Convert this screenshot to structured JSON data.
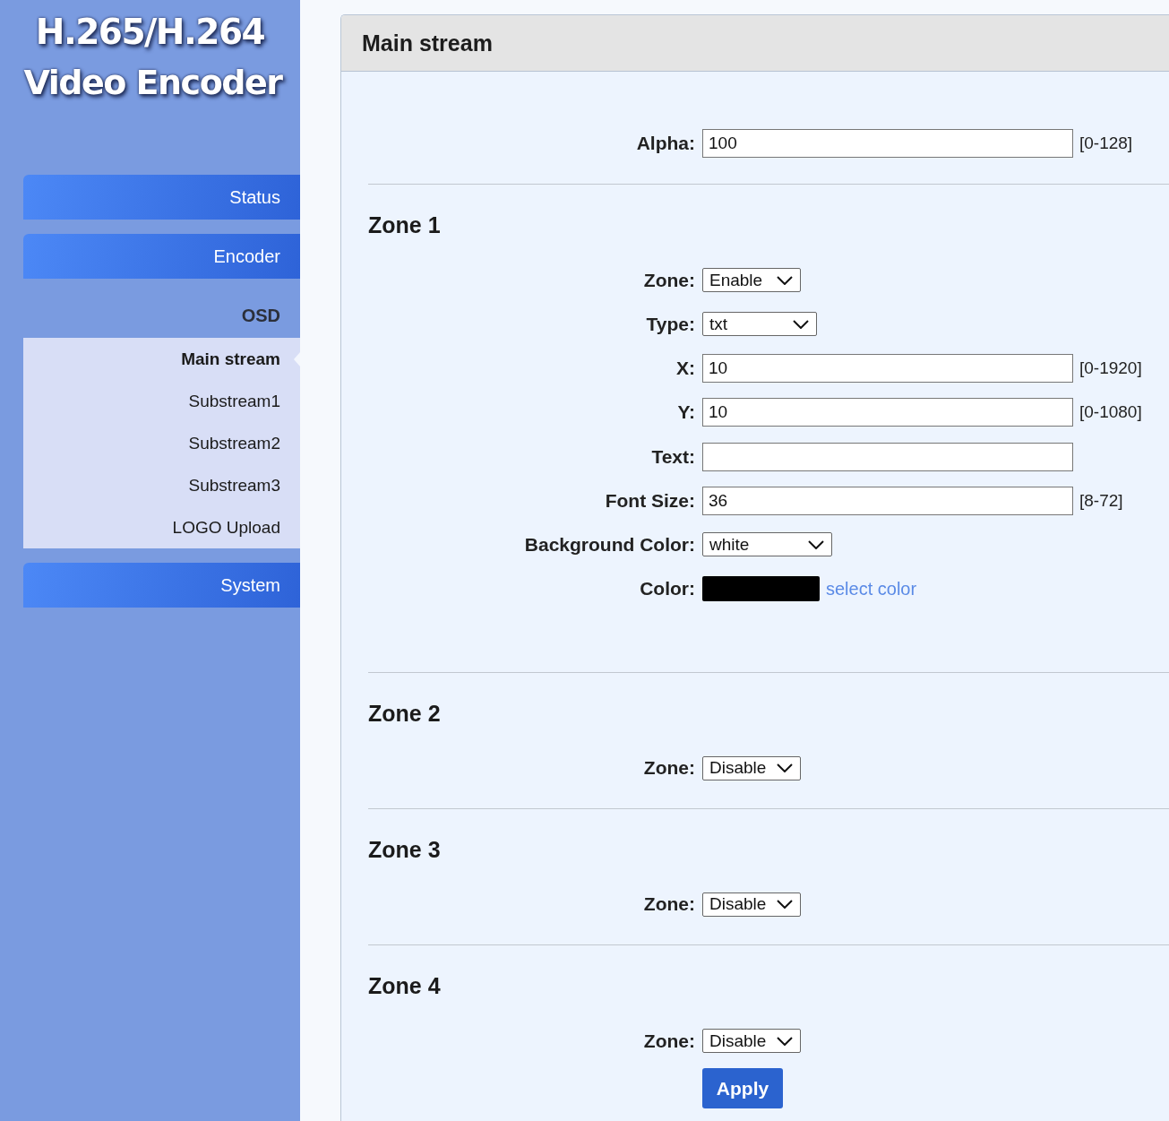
{
  "logo": {
    "lines": [
      "H.265/H.264",
      "Video Encoder"
    ]
  },
  "sidebar": {
    "items": [
      {
        "kind": "button",
        "label": "Status"
      },
      {
        "kind": "button",
        "label": "Encoder"
      },
      {
        "kind": "heading",
        "label": "OSD",
        "children": [
          {
            "label": "Main stream",
            "selected": true
          },
          {
            "label": "Substream1",
            "selected": false
          },
          {
            "label": "Substream2",
            "selected": false
          },
          {
            "label": "Substream3",
            "selected": false
          },
          {
            "label": "LOGO Upload",
            "selected": false
          }
        ]
      },
      {
        "kind": "button",
        "label": "System"
      }
    ]
  },
  "panel": {
    "title": "Main stream",
    "alpha": {
      "label": "Alpha:",
      "value": "100",
      "hint": "[0-128]"
    },
    "zones": [
      {
        "title": "Zone 1",
        "fields": [
          {
            "kind": "select",
            "label": "Zone:",
            "value": "Enable"
          },
          {
            "kind": "select",
            "label": "Type:",
            "value": "txt"
          },
          {
            "kind": "text",
            "label": "X:",
            "value": "10",
            "hint": "[0-1920]"
          },
          {
            "kind": "text",
            "label": "Y:",
            "value": "10",
            "hint": "[0-1080]"
          },
          {
            "kind": "text",
            "label": "Text:"
          },
          {
            "kind": "text",
            "label": "Font Size:",
            "value": "36",
            "hint": "[8-72]"
          },
          {
            "kind": "select",
            "label": "Background Color:",
            "value": "white"
          },
          {
            "kind": "color",
            "label": "Color:",
            "color": "#000000",
            "link": "select color"
          }
        ]
      },
      {
        "title": "Zone 2",
        "fields": [
          {
            "kind": "select",
            "label": "Zone:",
            "value": "Disable"
          }
        ]
      },
      {
        "title": "Zone 3",
        "fields": [
          {
            "kind": "select",
            "label": "Zone:",
            "value": "Disable"
          }
        ]
      },
      {
        "title": "Zone 4",
        "fields": [
          {
            "kind": "select",
            "label": "Zone:",
            "value": "Disable"
          }
        ]
      }
    ],
    "apply": "Apply"
  }
}
